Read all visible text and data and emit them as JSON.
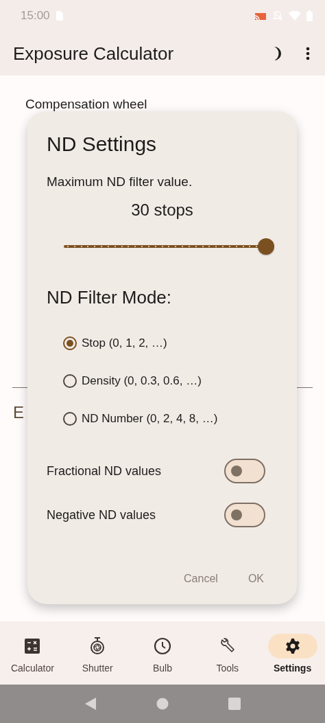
{
  "status_bar": {
    "time": "15:00"
  },
  "app_bar": {
    "title": "Exposure Calculator"
  },
  "background": {
    "row_label": "Compensation wheel",
    "section_heading": "E"
  },
  "dialog": {
    "title": "ND Settings",
    "slider_label": "Maximum ND filter value.",
    "reading": "30 stops",
    "level": 1,
    "mode_heading": "ND Filter Mode:",
    "modes": [
      {
        "label": "Stop (0, 1, 2, …)",
        "selected": true
      },
      {
        "label": "Density (0, 0.3, 0.6, …)",
        "selected": false
      },
      {
        "label": "ND Number (0, 2, 4, 8, …)",
        "selected": false
      }
    ],
    "switches": [
      {
        "label": "Fractional ND values",
        "on": false
      },
      {
        "label": "Negative ND values",
        "on": false
      }
    ],
    "buttons": [
      "Cancel",
      "OK"
    ]
  },
  "nav": [
    {
      "kind": "calculator",
      "label": "Calculator",
      "selected": false
    },
    {
      "kind": "shutter",
      "label": "Shutter",
      "selected": false
    },
    {
      "kind": "bulb",
      "label": "Bulb",
      "selected": false
    },
    {
      "kind": "tools",
      "label": "Tools",
      "selected": false
    },
    {
      "kind": "settings",
      "label": "Settings",
      "selected": true
    }
  ]
}
